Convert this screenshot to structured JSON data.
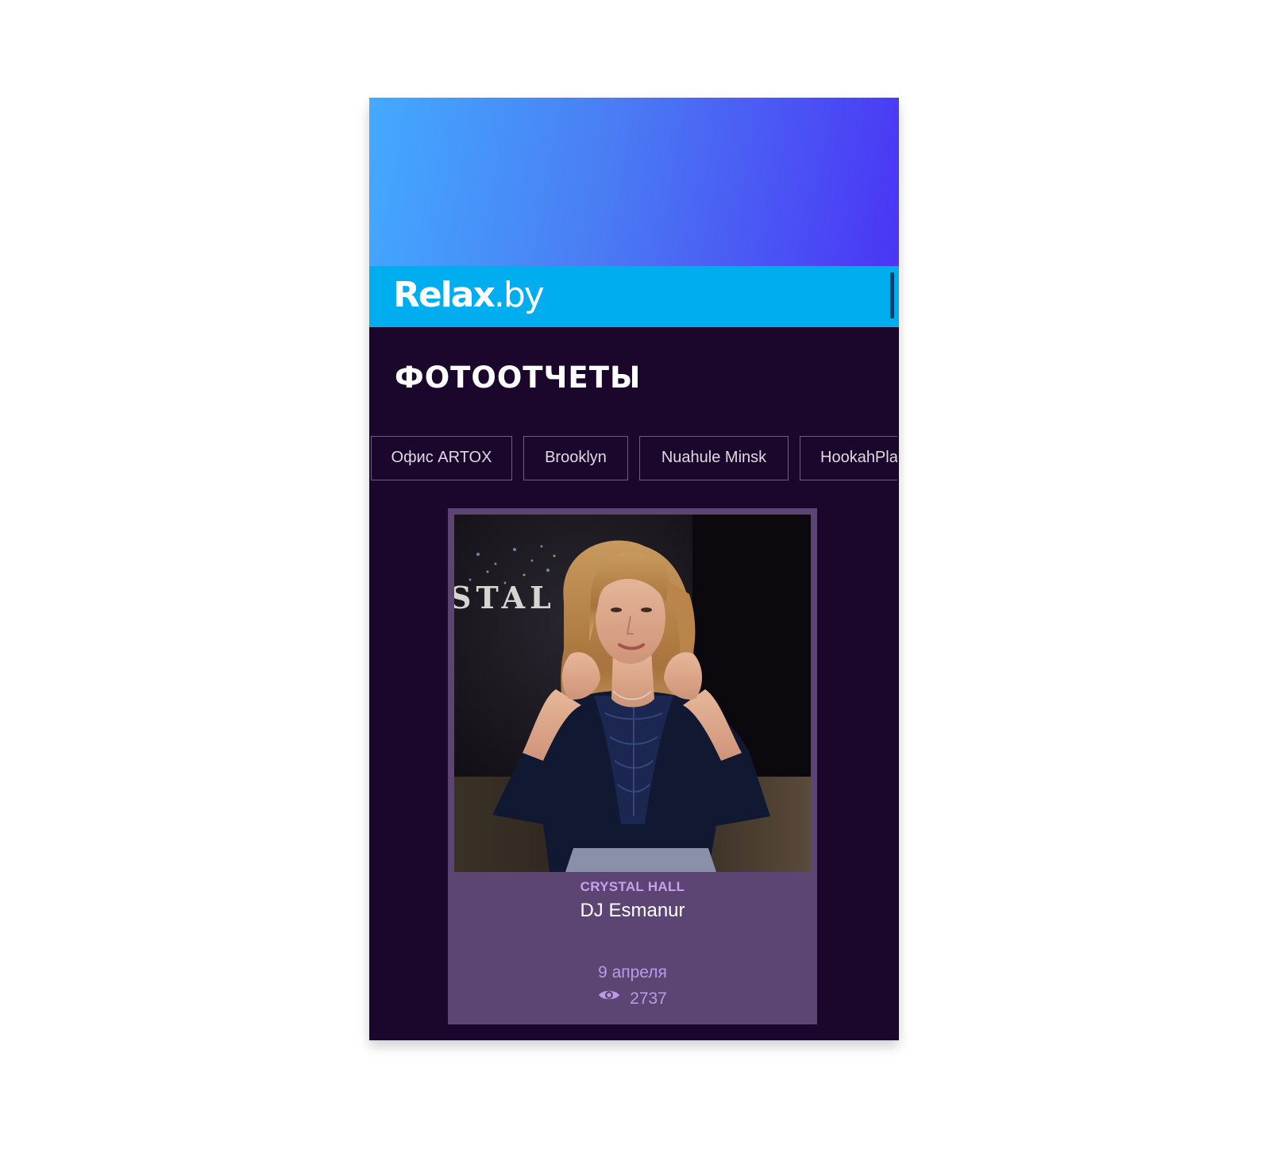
{
  "header": {
    "logo_brand": "Relax",
    "logo_tld": ".by"
  },
  "section": {
    "title": "ФОТООТЧЕТЫ"
  },
  "filters": [
    {
      "label": "Офис ARTOX"
    },
    {
      "label": "Brooklyn"
    },
    {
      "label": "Nuahule Minsk"
    },
    {
      "label": "HookahPla"
    }
  ],
  "card": {
    "venue": "CRYSTAL HALL",
    "title": "DJ Esmanur",
    "date": "9 апреля",
    "views": "2737",
    "views_icon": "eye-icon",
    "photo_sign_text": "STAL"
  },
  "colors": {
    "page_bg": "#1b072c",
    "topbar": "#00aeef",
    "card_bg": "#5d4573",
    "venue_text": "#c5a1ee"
  }
}
